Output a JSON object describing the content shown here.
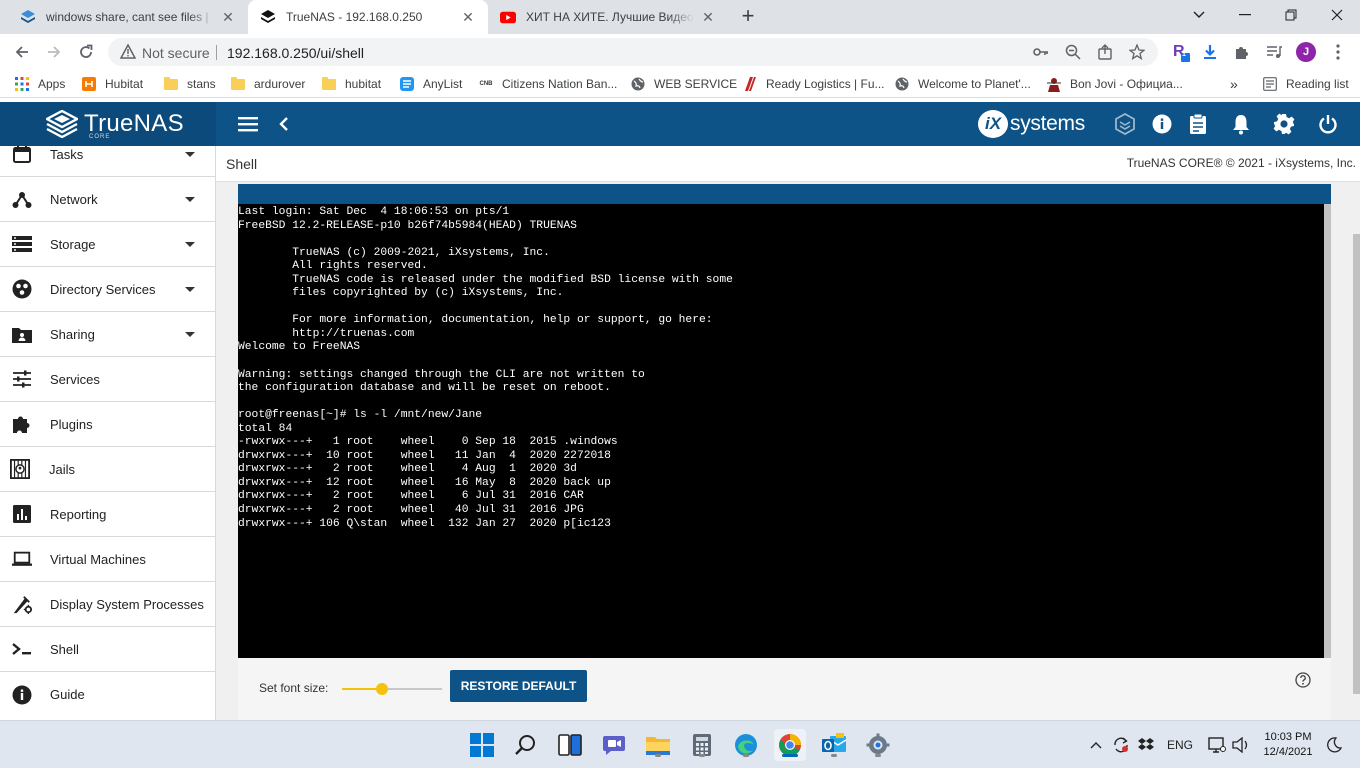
{
  "browser": {
    "tabs": [
      {
        "title": "windows share, cant see files | TrueNAS Community",
        "active": false
      },
      {
        "title": "TrueNAS - 192.168.0.250",
        "active": true
      },
      {
        "title": "ХИТ НА ХИТЕ. Лучшие Видео Клипы",
        "active": false
      }
    ],
    "security_label": "Not secure",
    "url": "192.168.0.250/ui/shell",
    "profile_initial": "J",
    "extension_badge": "1",
    "bookmarks": [
      "Apps",
      "Hubitat",
      "stans",
      "ardurover",
      "hubitat",
      "AnyList",
      "Citizens Nation Ban...",
      "WEB SERVICE",
      "Ready Logistics | Fu...",
      "Welcome to Planet'...",
      "Bon Jovi - Официа..."
    ],
    "bookmark_overflow": "»",
    "reading_list": "Reading list"
  },
  "app": {
    "logo_text": "TrueNAS",
    "logo_sub": "CORE",
    "vendor_ix": "iX",
    "vendor_systems": "systems",
    "colors": {
      "header": "#0e5387",
      "accent": "#f4c20d"
    }
  },
  "sidebar": {
    "items": [
      {
        "label": "Tasks",
        "icon": "calendar-icon",
        "caret": true
      },
      {
        "label": "Network",
        "icon": "network-icon",
        "caret": true
      },
      {
        "label": "Storage",
        "icon": "storage-icon",
        "caret": true
      },
      {
        "label": "Directory Services",
        "icon": "directory-icon",
        "caret": true
      },
      {
        "label": "Sharing",
        "icon": "sharing-icon",
        "caret": true
      },
      {
        "label": "Services",
        "icon": "sliders-icon",
        "caret": false
      },
      {
        "label": "Plugins",
        "icon": "puzzle-icon",
        "caret": false
      },
      {
        "label": "Jails",
        "icon": "jail-icon",
        "caret": false
      },
      {
        "label": "Reporting",
        "icon": "bar-chart-icon",
        "caret": false
      },
      {
        "label": "Virtual Machines",
        "icon": "laptop-icon",
        "caret": false
      },
      {
        "label": "Display System Processes",
        "icon": "processes-icon",
        "caret": false
      },
      {
        "label": "Shell",
        "icon": "terminal-icon",
        "caret": false
      },
      {
        "label": "Guide",
        "icon": "info-icon",
        "caret": false
      }
    ]
  },
  "page": {
    "breadcrumb": "Shell",
    "copyright": "TrueNAS CORE® © 2021 - iXsystems, Inc."
  },
  "terminal": {
    "lines": [
      "Last login: Sat Dec  4 18:06:53 on pts/1",
      "FreeBSD 12.2-RELEASE-p10 b26f74b5984(HEAD) TRUENAS",
      "",
      "        TrueNAS (c) 2009-2021, iXsystems, Inc.",
      "        All rights reserved.",
      "        TrueNAS code is released under the modified BSD license with some",
      "        files copyrighted by (c) iXsystems, Inc.",
      "",
      "        For more information, documentation, help or support, go here:",
      "        http://truenas.com",
      "Welcome to FreeNAS",
      "",
      "Warning: settings changed through the CLI are not written to",
      "the configuration database and will be reset on reboot.",
      "",
      "root@freenas[~]# ls -l /mnt/new/Jane",
      "total 84",
      "-rwxrwx---+   1 root    wheel    0 Sep 18  2015 .windows",
      "drwxrwx---+  10 root    wheel   11 Jan  4  2020 2272018",
      "drwxrwx---+   2 root    wheel    4 Aug  1  2020 3d",
      "drwxrwx---+  12 root    wheel   16 May  8  2020 back up",
      "drwxrwx---+   2 root    wheel    6 Jul 31  2016 CAR",
      "drwxrwx---+   2 root    wheel   40 Jul 31  2016 JPG",
      "drwxrwx---+ 106 Q\\stan  wheel  132 Jan 27  2020 p[ic123"
    ]
  },
  "font_controls": {
    "label": "Set font size:",
    "slider_fraction": 0.4,
    "restore_label": "RESTORE DEFAULT"
  },
  "taskbar": {
    "language": "ENG",
    "time": "10:03 PM",
    "date": "12/4/2021"
  }
}
